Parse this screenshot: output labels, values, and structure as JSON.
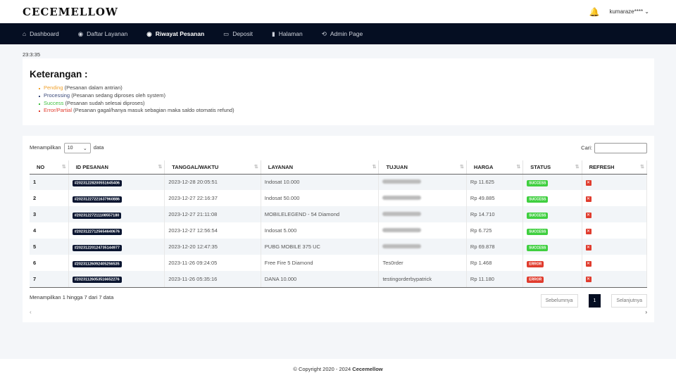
{
  "brand": "CECEMELLOW",
  "user": "kumaraze****",
  "nav": [
    {
      "label": "Dashboard",
      "icon": "home-icon"
    },
    {
      "label": "Daftar Layanan",
      "icon": "circle-icon"
    },
    {
      "label": "Riwayat Pesanan",
      "icon": "circle-icon"
    },
    {
      "label": "Deposit",
      "icon": "money-icon"
    },
    {
      "label": "Halaman",
      "icon": "file-icon"
    },
    {
      "label": "Admin Page",
      "icon": "admin-icon"
    }
  ],
  "clock": "23:3:35",
  "keterangan": {
    "title": "Keterangan :",
    "items": [
      {
        "term": "Pending",
        "desc": "(Pesanan dalam antrian)",
        "color": "#f0a22e"
      },
      {
        "term": "Processing",
        "desc": "(Pesanan sedang diproses oleh system)",
        "color": "#3b4a7a"
      },
      {
        "term": "Success",
        "desc": "(Pesanan sudah selesai diproses)",
        "color": "#3fbf3f"
      },
      {
        "term": "Error/Partial",
        "desc": "(Pesanan gagal/hanya masuk sebagian maka saldo otomatis refund)",
        "color": "#e03c2e"
      }
    ]
  },
  "table": {
    "show_prefix": "Menampilkan",
    "show_value": "10",
    "show_suffix": "data",
    "search_label": "Cari:",
    "headers": [
      "NO",
      "ID PESANAN",
      "TANGGAL/WAKTU",
      "LAYANAN",
      "TUJUAN",
      "HARGA",
      "STATUS",
      "REFRESH"
    ],
    "rows": [
      {
        "no": "1",
        "id": "#20231228200551645406",
        "date": "2023-12-28 20:05:51",
        "service": "Indosat 10.000",
        "target": "",
        "price": "Rp 11.625",
        "status": "SUCCESS"
      },
      {
        "no": "2",
        "id": "#20231227221637960886",
        "date": "2023-12-27 22:16:37",
        "service": "Indosat 50.000",
        "target": "",
        "price": "Rp 49.885",
        "status": "SUCCESS"
      },
      {
        "no": "3",
        "id": "#20231227211108557180",
        "date": "2023-12-27 21:11:08",
        "service": "MOBILELEGEND - 54 Diamond",
        "target": "",
        "price": "Rp 14.710",
        "status": "SUCCESS"
      },
      {
        "no": "4",
        "id": "#20231227125654640676",
        "date": "2023-12-27 12:56:54",
        "service": "Indosat 5.000",
        "target": "",
        "price": "Rp 6.725",
        "status": "SUCCESS"
      },
      {
        "no": "5",
        "id": "#20231220124735144977",
        "date": "2023-12-20 12:47:35",
        "service": "PUBG MOBILE 375 UC",
        "target": "",
        "price": "Rp 69.878",
        "status": "SUCCESS"
      },
      {
        "no": "6",
        "id": "#20231126092405256535",
        "date": "2023-11-26 09:24:05",
        "service": "Free Fire 5 Diamond",
        "target": "Tes0rder",
        "price": "Rp 1.468",
        "status": "ERROR"
      },
      {
        "no": "7",
        "id": "#20231126053516652276",
        "date": "2023-11-26 05:35:16",
        "service": "DANA 10.000",
        "target": "testingorderbypatrick",
        "price": "Rp 11.180",
        "status": "ERROR"
      }
    ],
    "info": "Menampilkan 1 hingga 7 dari 7 data",
    "prev": "Sebelumnya",
    "page": "1",
    "next": "Selanjutnya",
    "status_colors": {
      "SUCCESS": "#3fcf3f",
      "ERROR": "#e03c2e"
    }
  },
  "footer": {
    "text": "© Copyright 2020 - 2024 ",
    "brand": "Cecemellow"
  }
}
